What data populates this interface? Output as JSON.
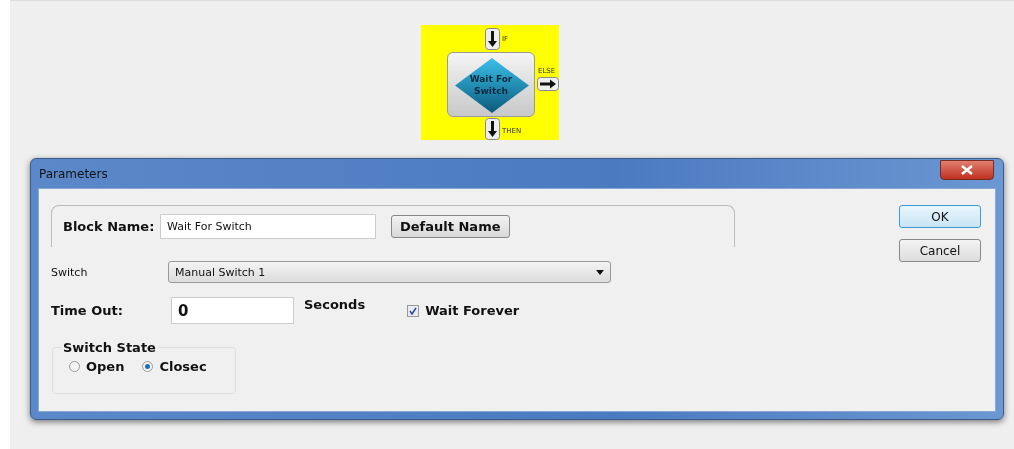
{
  "block": {
    "title": "Wait For Switch",
    "if_port": "IF",
    "else_port": "ELSE",
    "then_port": "THEN"
  },
  "dialog": {
    "title": "Parameters",
    "block_name": {
      "label": "Block Name:",
      "value": "Wait For Switch"
    },
    "default_button": "Default Name",
    "switch": {
      "label": "Switch",
      "value": "Manual Switch 1"
    },
    "time_out": {
      "label": "Time Out:",
      "value": "0",
      "unit": "Seconds"
    },
    "wait_forever": {
      "label": "Wait Forever",
      "checked": true
    },
    "switch_state": {
      "title": "Switch State",
      "options": [
        {
          "label": "Open",
          "selected": false
        },
        {
          "label": "Closec",
          "selected": true
        }
      ]
    },
    "buttons": [
      {
        "label": "OK",
        "default": true
      },
      {
        "label": "Cancel",
        "default": false
      }
    ]
  }
}
